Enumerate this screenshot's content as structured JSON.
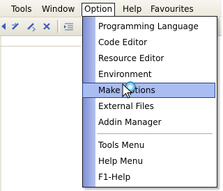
{
  "menubar": {
    "items": [
      {
        "label": "Tools"
      },
      {
        "label": "Window"
      },
      {
        "label": "Option"
      },
      {
        "label": "Help"
      },
      {
        "label": "Favourites"
      }
    ],
    "open_item": "Option"
  },
  "toolbar": {
    "buttons": [
      "bookmark-prev-icon",
      "bookmark-toggle-icon",
      "bookmark-next-icon",
      "bookmark-clear-icon",
      "indent-icon"
    ]
  },
  "option_menu": {
    "items": [
      {
        "label": "Programming Language"
      },
      {
        "label": "Code Editor"
      },
      {
        "label": "Resource Editor"
      },
      {
        "label": "Environment"
      },
      {
        "label": "Make Options",
        "highlighted": true
      },
      {
        "label": "External Files"
      },
      {
        "label": "Addin Manager"
      },
      {
        "label": "Tools Menu"
      },
      {
        "label": "Help Menu"
      },
      {
        "label": "F1-Help"
      }
    ]
  },
  "cursor": {
    "icon": "busy-pointer-icon"
  },
  "colors": {
    "menu_sidebar": "#8a9be0",
    "highlight_fill": "#a9bdf2",
    "highlight_border": "#2a3e86"
  }
}
